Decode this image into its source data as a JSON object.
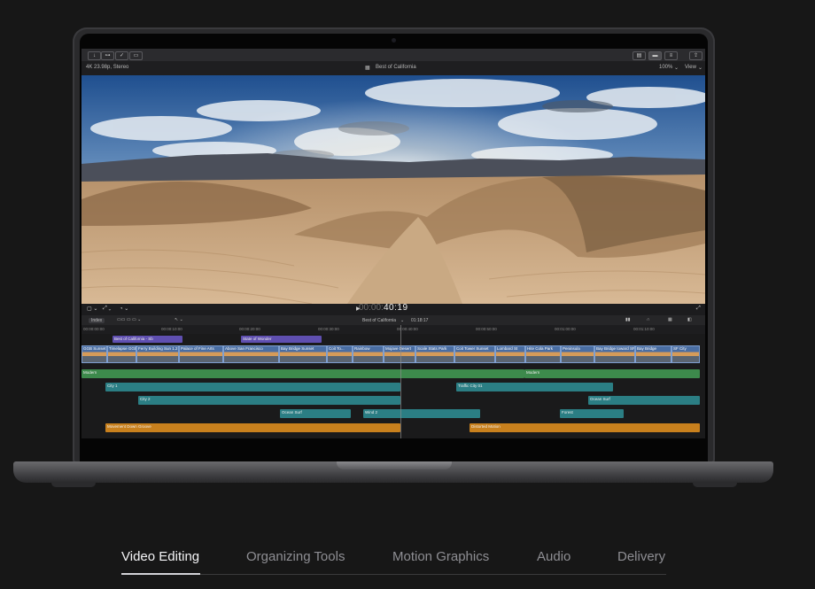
{
  "app": {
    "format_label": "4K 23.98p, Stereo",
    "project_title": "Best of California",
    "zoom": "100%",
    "view_menu": "View",
    "timecode_dim": "00:00:",
    "timecode": "40:19",
    "index_button": "Index",
    "timeline_title": "Best of California",
    "timeline_duration": "01:18:17"
  },
  "ruler_ticks": [
    "00:00:00:00",
    "00:00:10:00",
    "00:00:20:00",
    "00:00:30:00",
    "00:00:40:00",
    "00:00:50:00",
    "00:01:00:00",
    "00:01:10:00"
  ],
  "title_clips": [
    "Best of California - Sb",
    "State of Wonder"
  ],
  "video_clips": [
    "GGB Sunset",
    "Timelapse GGB",
    "Ferry Building Sun 1.2",
    "Palace of Fine Arts",
    "Above San Francisco",
    "Bay Bridge Sunset",
    "Coit To...",
    "Rainbow",
    "Mojave Desert",
    "Scale Stats Park",
    "Coit Tower Sunset",
    "Lombard St",
    "Hite Cola Park",
    "Peninsula",
    "Bay Bridge toward SF",
    "Bay Bridge",
    "SF City"
  ],
  "audio_clips": {
    "modern_1": "Modern",
    "modern_2": "Modern",
    "city_1": "City 1",
    "traffic": "Traffic City 01",
    "city_2": "City 2",
    "ocean_surf_right": "Ocean Surf",
    "ocean_surf": "Ocean Surf",
    "wind": "Wind 2",
    "forest": "Forest",
    "movement_1": "Movement Down Groove",
    "movement_2": "Distorted Motion"
  },
  "tabs": [
    {
      "label": "Video Editing",
      "active": true
    },
    {
      "label": "Organizing Tools",
      "active": false
    },
    {
      "label": "Motion Graphics",
      "active": false
    },
    {
      "label": "Audio",
      "active": false
    },
    {
      "label": "Delivery",
      "active": false
    }
  ],
  "colors": {
    "title_clip": "#5f4fb0",
    "music_track": "#3d8a4c",
    "fx_track": "#2b7e84",
    "sfx_track": "#c8801d",
    "active_tab": "#f5f5f7",
    "inactive_tab": "#8e8e93"
  },
  "icons": [
    "import-icon",
    "keyword-icon",
    "analysis-icon",
    "background-tasks-icon",
    "layout-icon",
    "play-icon",
    "fullscreen-icon",
    "headphones-icon",
    "inspector-icon"
  ]
}
